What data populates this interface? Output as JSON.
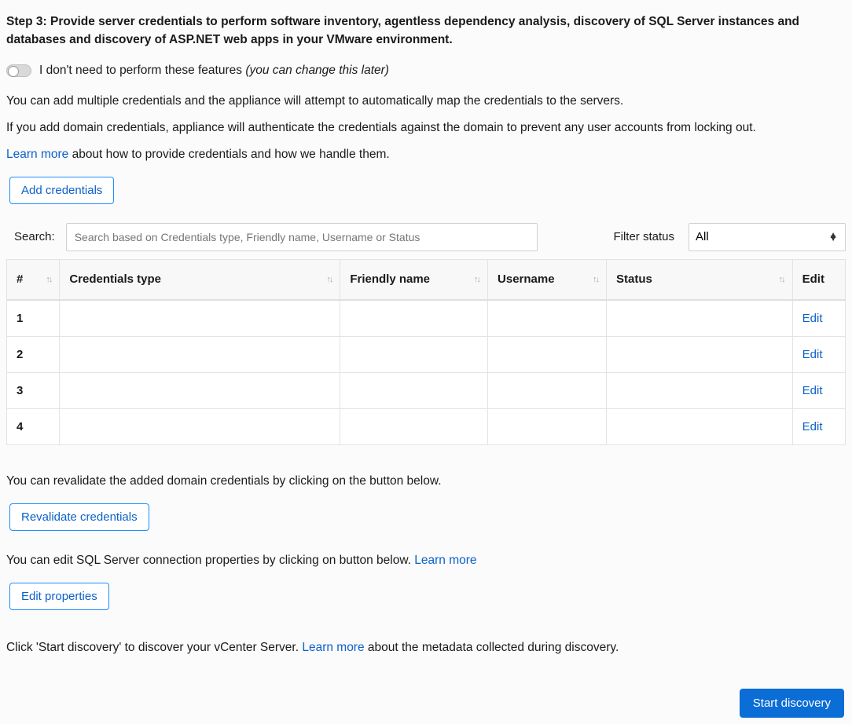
{
  "step_heading": "Step 3: Provide server credentials to perform software inventory, agentless dependency analysis, discovery of SQL Server instances and databases and discovery of ASP.NET web apps in your VMware environment.",
  "toggle": {
    "label_main": "I don't need to perform these features ",
    "label_hint": "(you can change this later)"
  },
  "desc1": "You can add multiple credentials and the appliance will attempt to automatically map the credentials to the servers.",
  "desc2": "If you add domain credentials, appliance will authenticate the credentials against  the domain to prevent any user accounts from locking out.",
  "learn_more": "Learn more",
  "learn_more_tail": " about how to provide credentials and how we handle them.",
  "add_credentials": "Add credentials",
  "search": {
    "label": "Search:",
    "placeholder": "Search based on Credentials type, Friendly name, Username or Status"
  },
  "filter": {
    "label": "Filter status",
    "selected": "All"
  },
  "table": {
    "headers": {
      "num": "#",
      "type": "Credentials type",
      "friendly": "Friendly name",
      "user": "Username",
      "status": "Status",
      "edit": "Edit"
    },
    "rows": [
      {
        "num": "1",
        "type": "",
        "friendly": "",
        "user": "",
        "status": "",
        "edit": "Edit"
      },
      {
        "num": "2",
        "type": "",
        "friendly": "",
        "user": "",
        "status": "",
        "edit": "Edit"
      },
      {
        "num": "3",
        "type": "",
        "friendly": "",
        "user": "",
        "status": "",
        "edit": "Edit"
      },
      {
        "num": "4",
        "type": "",
        "friendly": "",
        "user": "",
        "status": "",
        "edit": "Edit"
      }
    ]
  },
  "revalidate_desc": "You can revalidate the added domain credentials by clicking on the button below.",
  "revalidate_btn": "Revalidate credentials",
  "editprops_desc_pre": "You can edit SQL Server connection properties by clicking on button below. ",
  "editprops_learn": "Learn more",
  "editprops_btn": "Edit properties",
  "start_desc_pre": "Click 'Start discovery' to discover your vCenter Server. ",
  "start_learn": "Learn more",
  "start_desc_post": " about the metadata collected during discovery.",
  "start_btn": "Start discovery"
}
